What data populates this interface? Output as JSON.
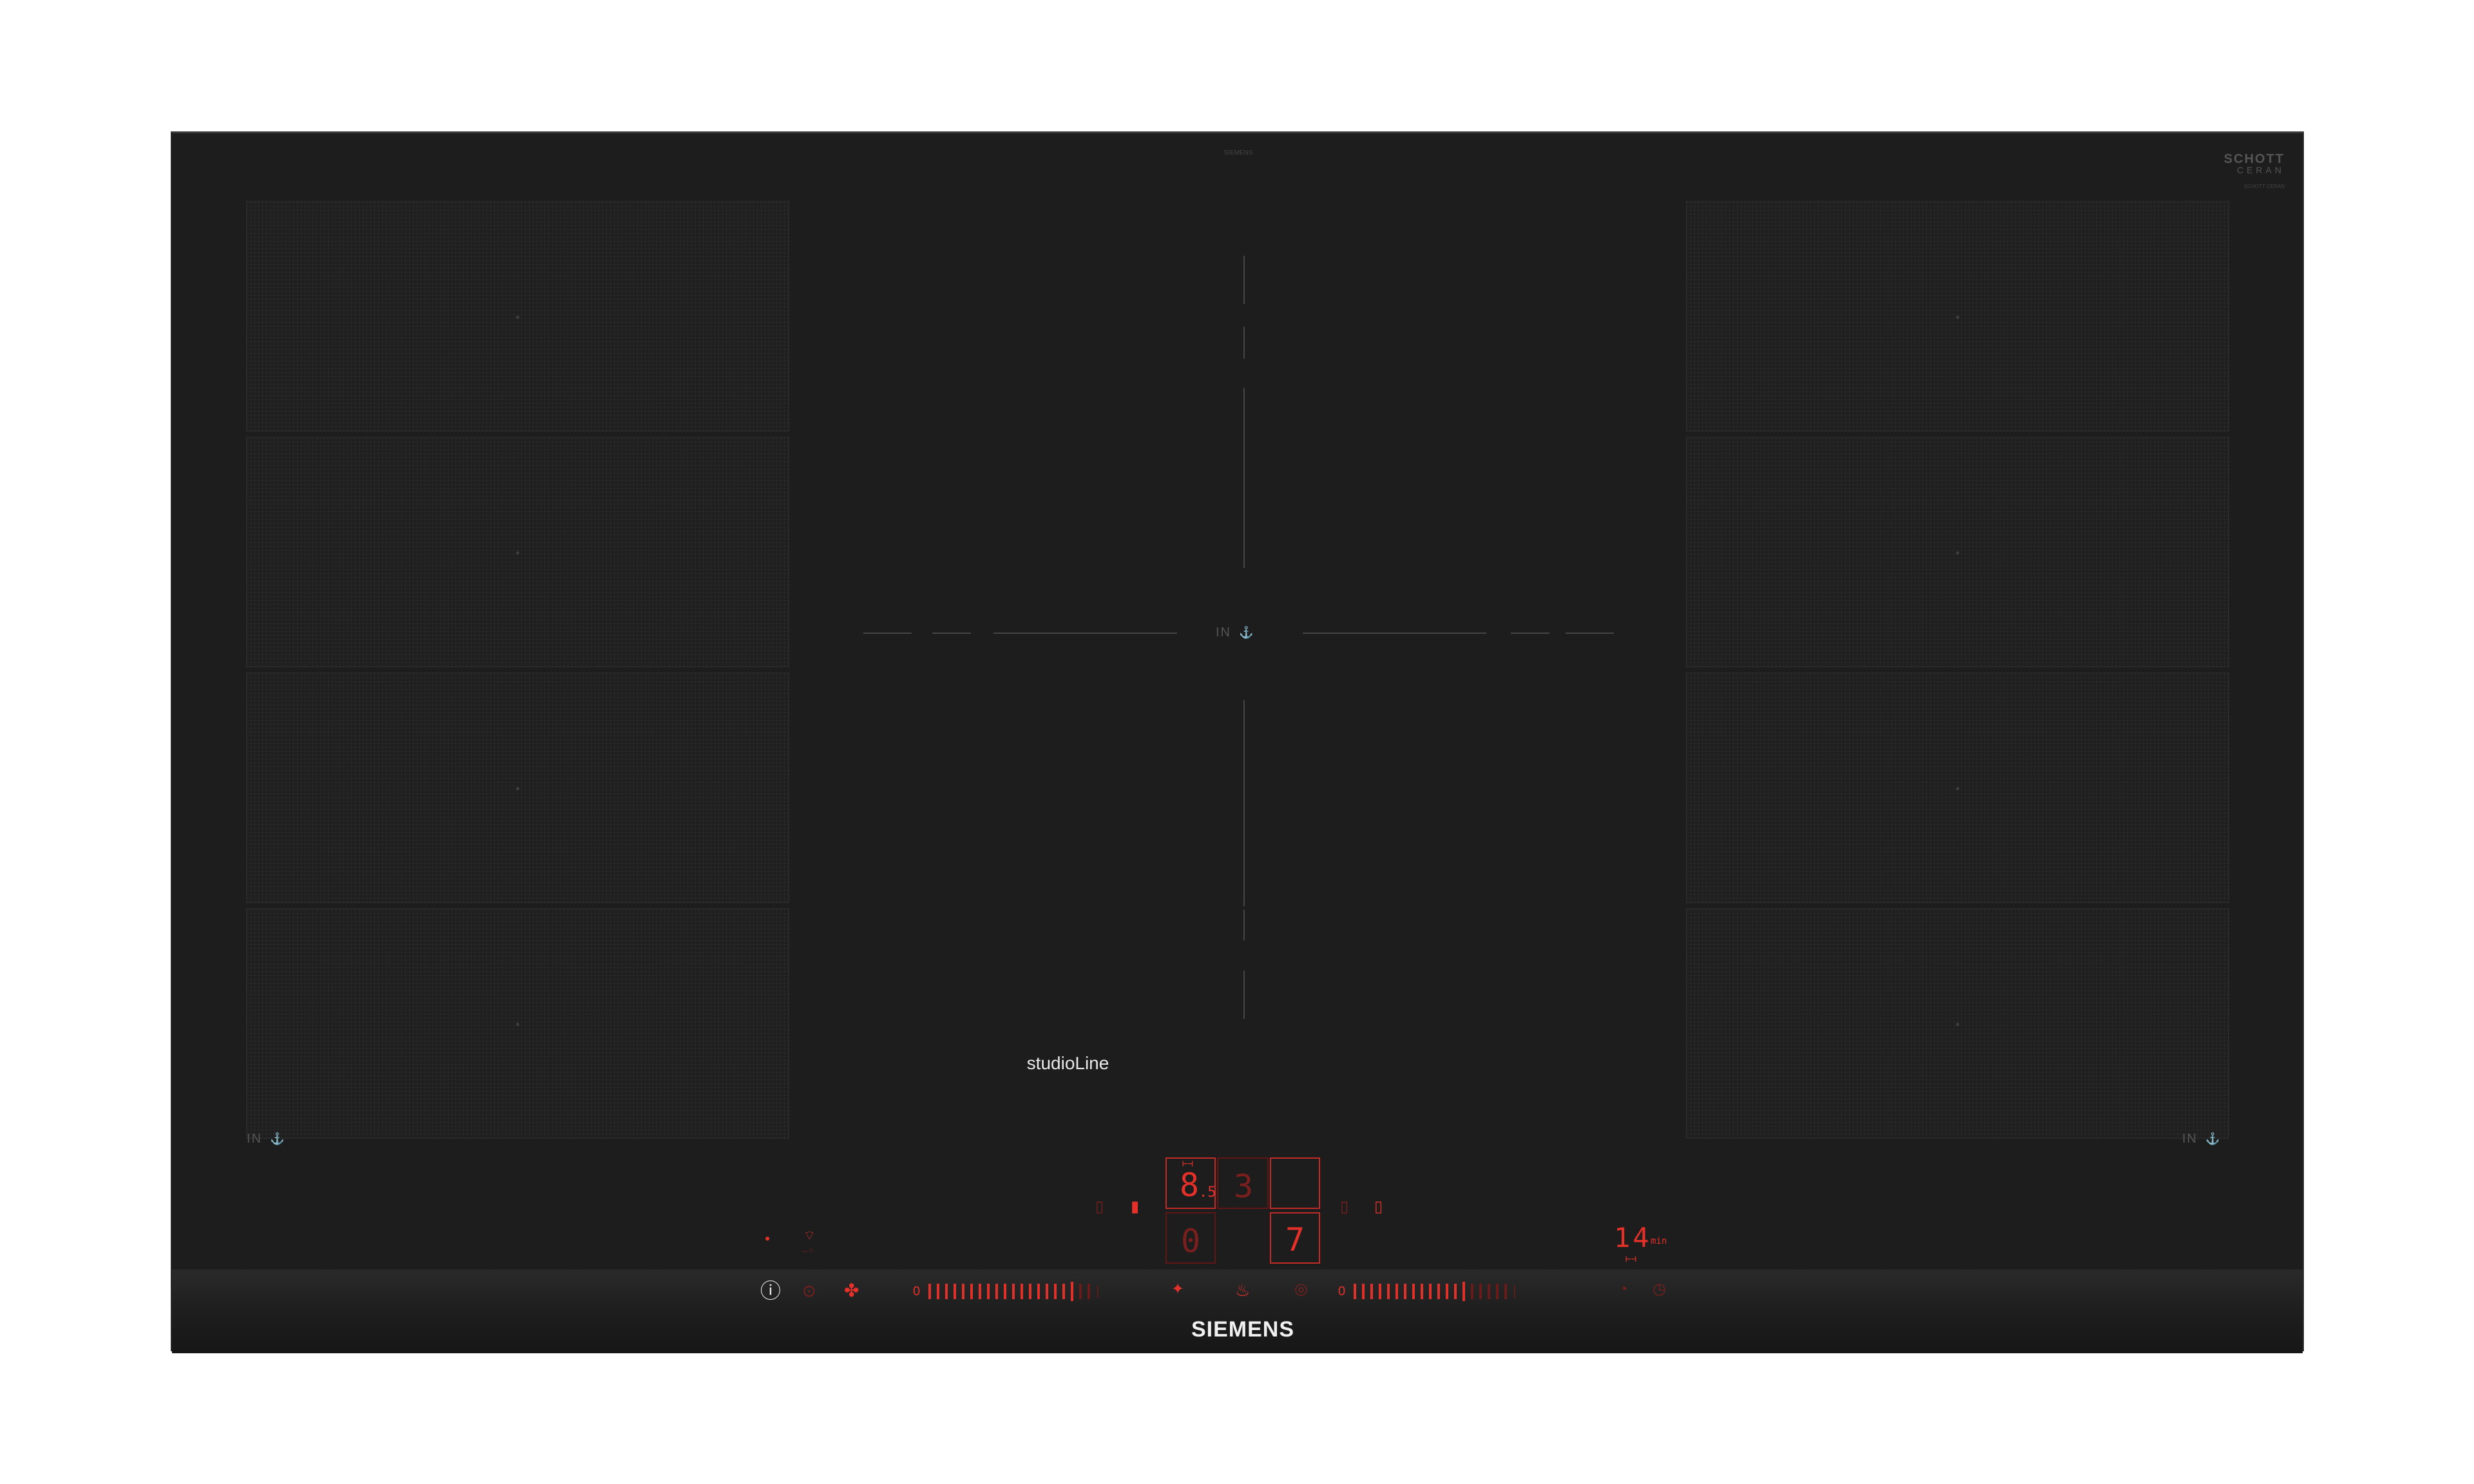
{
  "hob": {
    "maker_mark": "SIEMENS",
    "schott_line1": "SCHOTT",
    "schott_line2": "CERAN",
    "schott_line3": "SCHOTT CERAN",
    "series": "studioLine",
    "brand": "SIEMENS",
    "in_label": "IN",
    "in_symbol": "⚓",
    "zones_left": 4,
    "zones_right": 4
  },
  "center_display": {
    "flex_top_left": "8",
    "flex_top_left_small": ".5",
    "flex_top_left_marker": "⊢⊣",
    "flex_top_middle": "3",
    "flex_top_right": "",
    "flex_bottom_left": "0",
    "flex_bottom_right": "7",
    "left_indicator_a": "▯",
    "left_indicator_b": "▮",
    "right_indicator_a": "▯",
    "right_indicator_b": "▯"
  },
  "timer": {
    "value": "14",
    "unit": "min",
    "marker": "⊢⊣"
  },
  "controls": {
    "power_icon": "ⓘ",
    "power_dot": "●",
    "wifi_icon": "⌔",
    "home_connect_label": "↔○",
    "lock_icon": "⊙",
    "fan_icon": "✤",
    "left_slider_zero": "0",
    "right_slider_zero": "0",
    "left_slider_end": "|",
    "right_slider_end": "|",
    "boost_icon": "✦",
    "steam_icon": "♨",
    "pan_icon": "◎",
    "timer_icon_a": "◔",
    "timer_icon_b": "◷"
  },
  "colors": {
    "glass": "#1d1d1d",
    "display_red": "#e5302a",
    "display_dim": "#6a1a18",
    "strip": "#222222"
  }
}
